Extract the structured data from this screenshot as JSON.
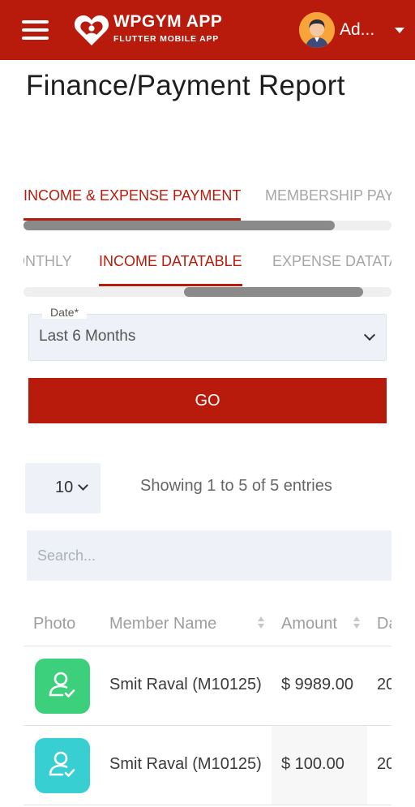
{
  "colors": {
    "brand": "#b81b0b",
    "tab_inactive": "#a6a6a6",
    "field_bg": "#eef1f7",
    "photo_green": "#3ccf7c",
    "photo_teal": "#38cfd3"
  },
  "header": {
    "menu_icon": "hamburger-menu-icon",
    "logo_icon": "heart-logo-icon",
    "app_title": "WPGYM APP",
    "app_subtitle": "FLUTTER MOBILE APP",
    "user_label": "Ad...",
    "avatar_icon": "user-avatar",
    "dropdown_icon": "caret-down-icon"
  },
  "page": {
    "title": "Finance/Payment Report"
  },
  "primary_tabs": [
    {
      "label": "INCOME & EXPENSE PAYMENT",
      "active": true
    },
    {
      "label": "MEMBERSHIP PAYMENT",
      "active": false
    }
  ],
  "secondary_tabs": [
    {
      "label": "MONTHLY",
      "active": false
    },
    {
      "label": "INCOME DATATABLE",
      "active": true
    },
    {
      "label": "EXPENSE DATATABLE",
      "active": false
    }
  ],
  "filter": {
    "date_label": "Date*",
    "date_value": "Last 6 Months",
    "go_label": "GO"
  },
  "table_controls": {
    "page_length": "10",
    "info": "Showing 1 to 5 of 5 entries",
    "search_placeholder": "Search..."
  },
  "table": {
    "columns": [
      "Photo",
      "Member Name",
      "Amount",
      "Date"
    ],
    "rows": [
      {
        "photo_icon": "user-check-icon",
        "member": "Smit Raval (M10125)",
        "amount": "$ 9989.00",
        "date": "20"
      },
      {
        "photo_icon": "user-check-icon",
        "member": "Smit Raval (M10125)",
        "amount": "$ 100.00",
        "date": "20"
      }
    ]
  }
}
